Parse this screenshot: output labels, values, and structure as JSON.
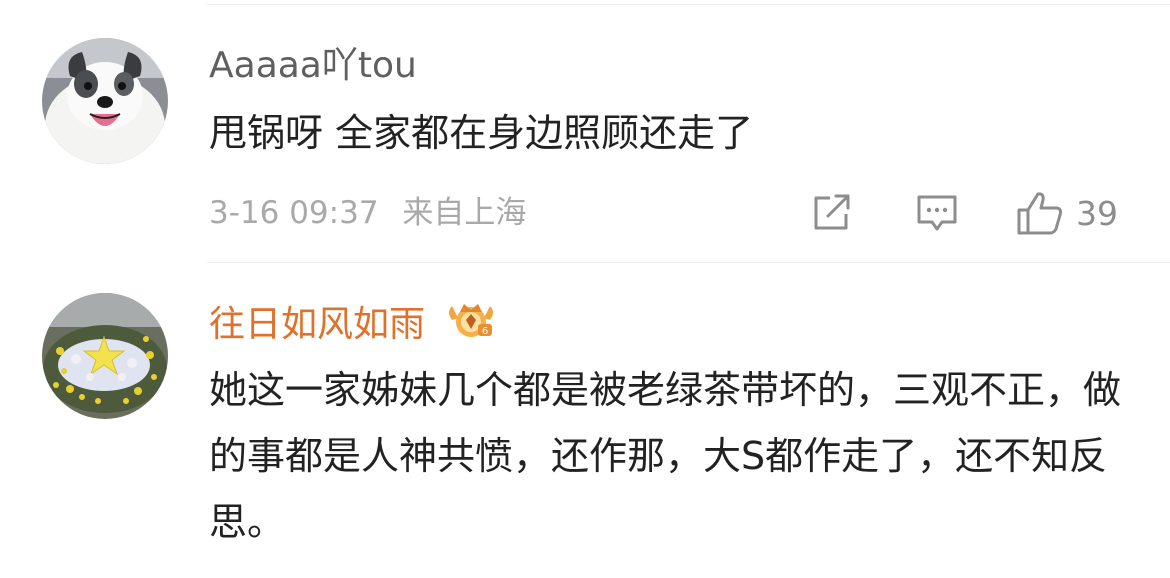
{
  "comments": [
    {
      "username": "Aaaaa吖tou",
      "text": "甩锅呀 全家都在身边照顾还走了",
      "time": "3-16 09:37",
      "location": "来自上海",
      "likes": "39",
      "avatar_icon": "dog-avatar",
      "username_color": "#5f5f5f"
    },
    {
      "username": "往日如风如雨",
      "text": "她这一家姊妹几个都是被老绿茶带坏的，三观不正，做的事都是人神共愤，还作那，大S都作走了，还不知反思。",
      "avatar_icon": "flowers-star-avatar",
      "badge_icon": "crown-vip-badge-icon",
      "username_color": "#e0702a"
    }
  ]
}
